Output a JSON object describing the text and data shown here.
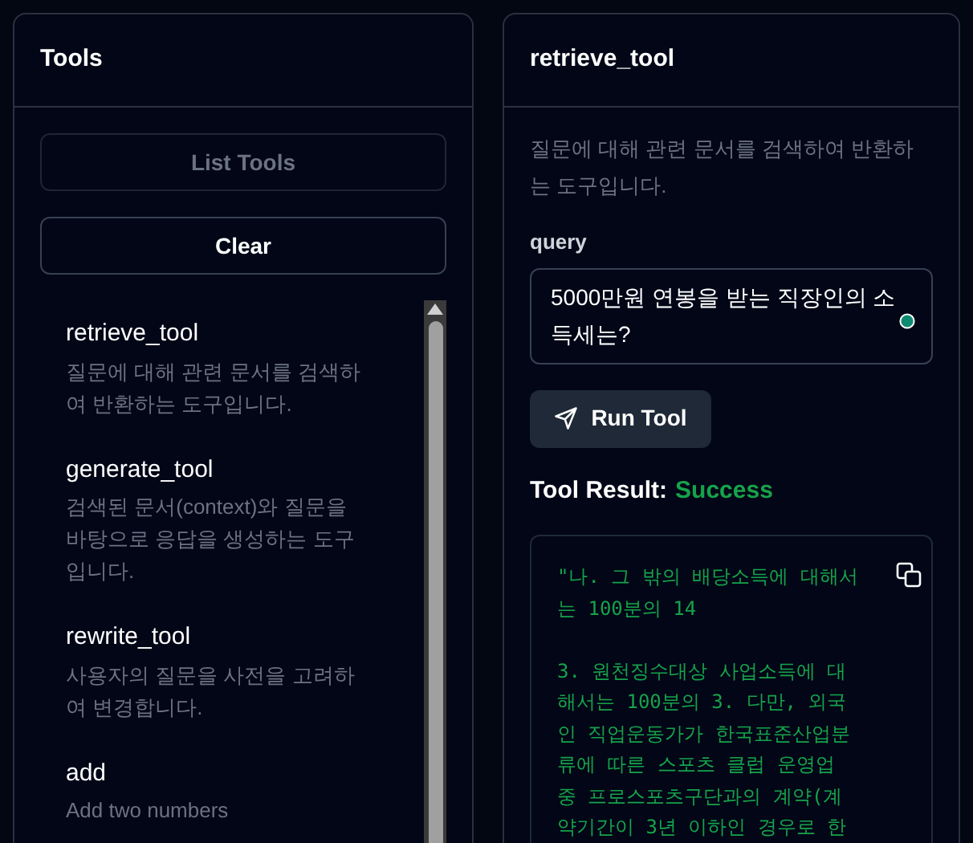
{
  "tools_panel": {
    "title": "Tools",
    "buttons": [
      {
        "label": "List Tools",
        "disabled": true
      },
      {
        "label": "Clear",
        "disabled": false
      }
    ],
    "items": [
      {
        "name": "retrieve_tool",
        "description": "질문에 대해 관련 문서를 검색하여 반환하는 도구입니다."
      },
      {
        "name": "generate_tool",
        "description": "검색된 문서(context)와 질문을 바탕으로 응답을 생성하는 도구입니다."
      },
      {
        "name": "rewrite_tool",
        "description": "사용자의 질문을 사전을 고려하여 변경합니다."
      },
      {
        "name": "add",
        "description": "Add two numbers"
      }
    ]
  },
  "detail_panel": {
    "title": "retrieve_tool",
    "description": "질문에 대해 관련 문서를 검색하여 반환하는 도구입니다.",
    "field_label": "query",
    "field_value": "5000만원 연봉을 받는 직장인의 소득세는?",
    "run_button": "Run Tool",
    "result_label": "Tool Result:",
    "result_status": "Success",
    "status_ok": true,
    "result_text": "\"나. 그 밖의 배당소득에 대해서\n는 100분의 14\n\n3. 원천징수대상 사업소득에 대\n해서는 100분의 3. 다만, 외국\n인 직업운동가가 한국표준산업분\n류에 따른 스포츠 클럽 운영업\n중 프로스포츠구단과의 계약(계\n약기간이 3년 이하인 경우로 한"
  }
}
